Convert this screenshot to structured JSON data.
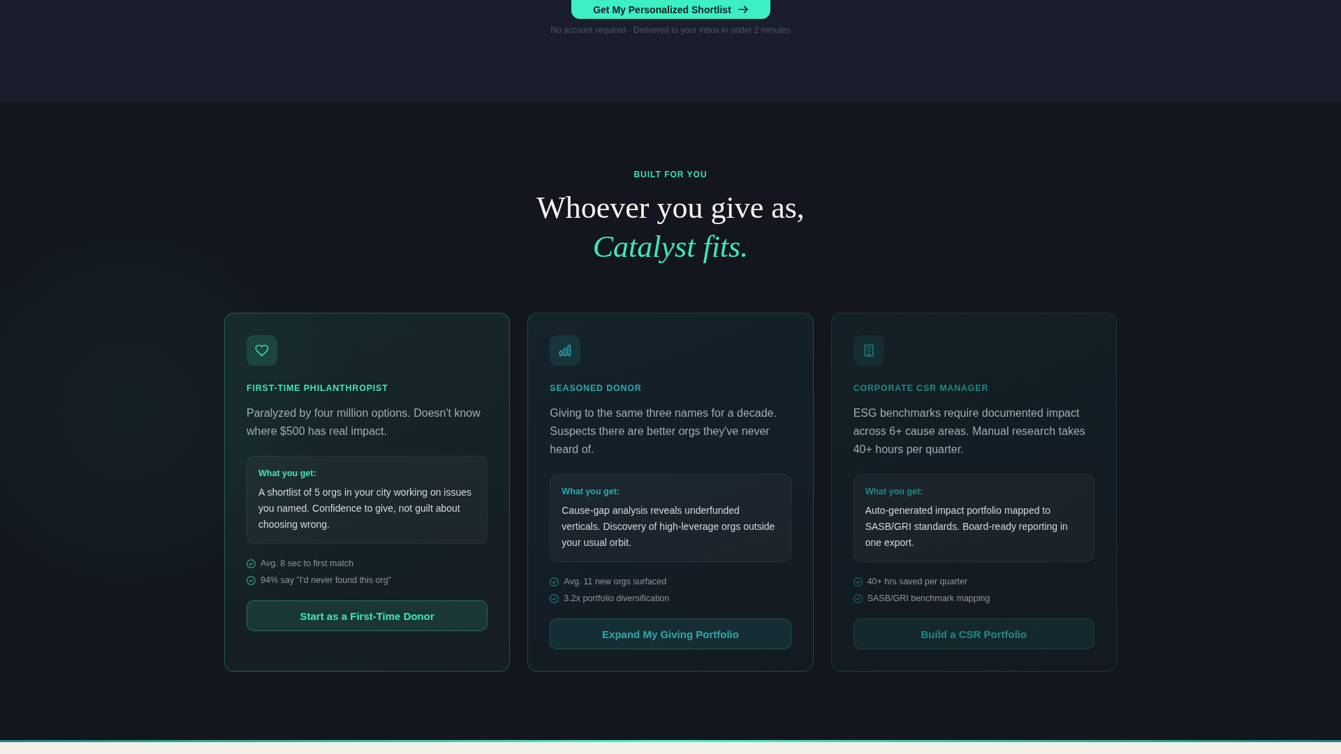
{
  "hero_cta": {
    "button": "Get My Personalized Shortlist",
    "note": "No account required · Delivered to your inbox in under 2 minutes"
  },
  "section": {
    "eyebrow": "BUILT FOR YOU",
    "heading": "Whoever you give as, *Catalyst fits.*",
    "cards": [
      {
        "kind": "individual",
        "color": "#3ee8b5",
        "title": "FIRST-TIME PHILANTHROPIST",
        "description": "Paralyzed by four million options. Doesn't know where $500 has real impact.",
        "benefit_label": "What you get:",
        "benefit": "A shortlist of 5 orgs in your city working on issues you named. Confidence to give, not guilt about choosing wrong.",
        "stats": [
          "Avg. 8 sec to first match",
          "94% say \"I'd never found this org\""
        ],
        "button": "Start as a First-Time Donor"
      },
      {
        "kind": "donor",
        "color": "#2aabad",
        "title": "SEASONED DONOR",
        "description": "Giving to the same three names for a decade. Suspects there are better orgs they've never heard of.",
        "benefit_label": "What you get:",
        "benefit": "Cause-gap analysis reveals underfunded verticals. Discovery of high-leverage orgs outside your usual orbit.",
        "stats": [
          "Avg. 11 new orgs surfaced",
          "3.2x portfolio diversification"
        ],
        "button": "Expand My Giving Portfolio"
      },
      {
        "kind": "corporate",
        "color": "#1f8a85",
        "title": "CORPORATE CSR MANAGER",
        "description": "ESG benchmarks require documented impact across 6+ cause areas. Manual research takes 40+ hours per quarter.",
        "benefit_label": "What you get:",
        "benefit": "Auto-generated impact portfolio mapped to SASB/GRI standards. Board-ready reporting in one export.",
        "stats": [
          "40+ hrs saved per quarter",
          "SASB/GRI benchmark mapping"
        ],
        "button": "Build a CSR Portfolio"
      }
    ]
  }
}
